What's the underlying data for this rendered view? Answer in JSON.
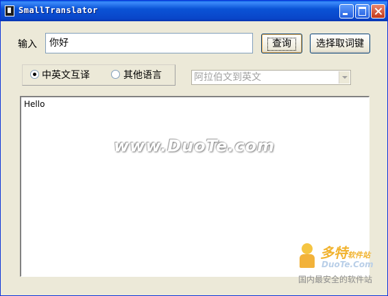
{
  "window": {
    "title": "SmallTranslator"
  },
  "input": {
    "label": "输入",
    "value": "你好"
  },
  "buttons": {
    "query": "查询",
    "hotkey": "选择取词键"
  },
  "mode": {
    "options": [
      {
        "label": "中英文互译",
        "checked": true
      },
      {
        "label": "其他语言",
        "checked": false
      }
    ]
  },
  "language_select": {
    "selected": "阿拉伯文到英文",
    "disabled": true
  },
  "output": {
    "text": "Hello"
  },
  "watermark": {
    "text": "www.DuoTe.com"
  },
  "logo": {
    "name": "多特",
    "suffix": "软件站",
    "domain": "DuoTe.Com",
    "tagline": "国内最安全的软件站"
  },
  "colors": {
    "titlebar": "#0a53d6",
    "window_bg": "#ece9d8",
    "close_button": "#c4391a"
  }
}
